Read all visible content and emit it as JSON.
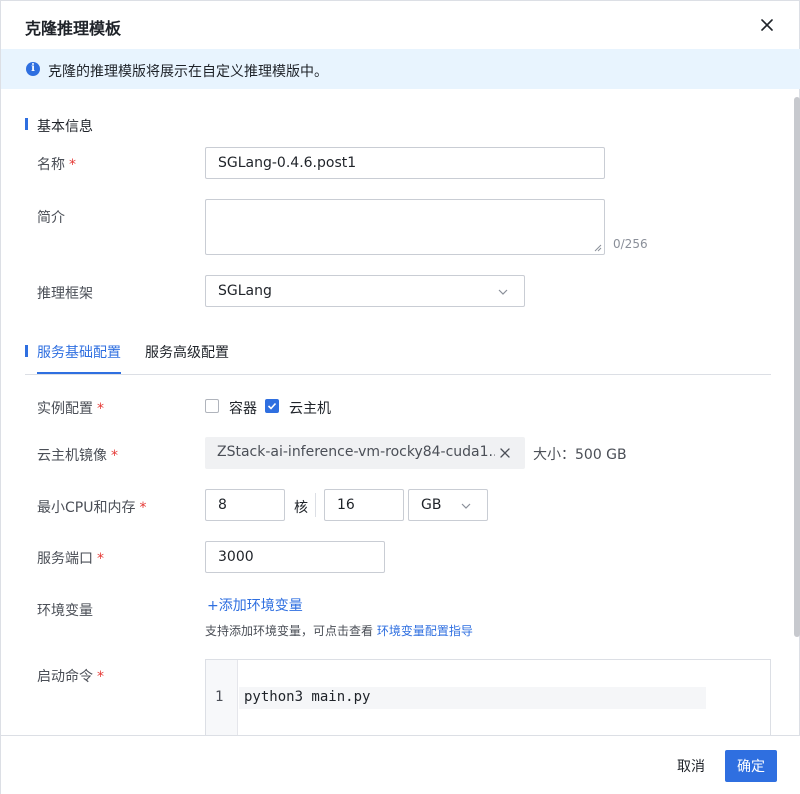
{
  "dialog": {
    "title": "克隆推理模板",
    "close_icon": "close-icon"
  },
  "banner": {
    "icon": "info-icon",
    "icon_glyph": "i",
    "text": "克隆的推理模版将展示在自定义推理模版中。"
  },
  "basic": {
    "section_title": "基本信息",
    "name_label": "名称",
    "name_value": "SGLang-0.4.6.post1",
    "desc_label": "简介",
    "desc_counter": "0/256",
    "framework_label": "推理框架",
    "framework_value": "SGLang"
  },
  "tabs": [
    {
      "label": "服务基础配置",
      "active": true
    },
    {
      "label": "服务高级配置",
      "active": false
    }
  ],
  "config": {
    "instance_label": "实例配置",
    "option_container": "容器",
    "option_container_checked": false,
    "option_vm": "云主机",
    "option_vm_checked": true,
    "image_label": "云主机镜像",
    "image_value": "ZStack-ai-inference-vm-rocky84-cuda1...",
    "image_size": "大小：500 GB",
    "cpu_mem_label": "最小CPU和内存",
    "cpu_value": "8",
    "cpu_unit": "核",
    "mem_value": "16",
    "mem_unit": "GB",
    "port_label": "服务端口",
    "port_value": "3000",
    "env_label": "环境变量",
    "env_add_link": "+添加环境变量",
    "env_help_text": "支持添加环境变量，可点击查看 ",
    "env_help_link": "环境变量配置指导",
    "cmd_label": "启动命令",
    "cmd_line_number": "1",
    "cmd_code": "python3 main.py"
  },
  "required_mark": "*",
  "footer": {
    "cancel": "取消",
    "confirm": "确定"
  },
  "colors": {
    "accent": "#2f6fe0",
    "required": "#e53935",
    "banner_bg": "#e8f4fe"
  }
}
